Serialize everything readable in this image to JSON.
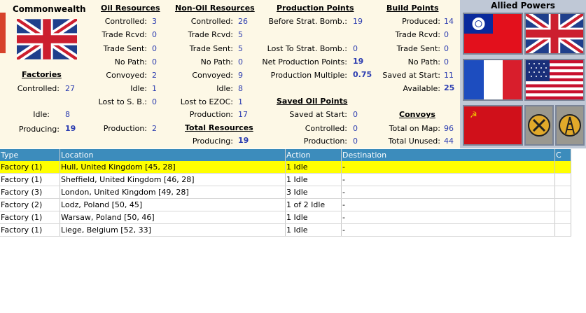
{
  "country": "Commonwealth",
  "factories": {
    "header": "Factories",
    "controlled_label": "Controlled:",
    "controlled": "27",
    "idle_label": "Idle:",
    "idle": "8",
    "producing_label": "Producing:",
    "producing": "19"
  },
  "oil": {
    "header": "Oil Resources",
    "controlled_label": "Controlled:",
    "controlled": "3",
    "trade_rcvd_label": "Trade Rcvd:",
    "trade_rcvd": "0",
    "trade_sent_label": "Trade Sent:",
    "trade_sent": "0",
    "no_path_label": "No Path:",
    "no_path": "0",
    "convoyed_label": "Convoyed:",
    "convoyed": "2",
    "idle_label": "Idle:",
    "idle": "1",
    "lost_sb_label": "Lost to S. B.:",
    "lost_sb": "0",
    "production_label": "Production:",
    "production": "2"
  },
  "nonoil": {
    "header": "Non-Oil Resources",
    "controlled_label": "Controlled:",
    "controlled": "26",
    "trade_rcvd_label": "Trade Rcvd:",
    "trade_rcvd": "5",
    "trade_sent_label": "Trade Sent:",
    "trade_sent": "5",
    "no_path_label": "No Path:",
    "no_path": "0",
    "convoyed_label": "Convoyed:",
    "convoyed": "9",
    "idle_label": "Idle:",
    "idle": "8",
    "lost_ezoc_label": "Lost to EZOC:",
    "lost_ezoc": "1",
    "production_label": "Production:",
    "production": "17"
  },
  "total": {
    "header": "Total Resources",
    "producing_label": "Producing:",
    "producing": "19"
  },
  "pp": {
    "header": "Production Points",
    "before_label": "Before Strat. Bomb.:",
    "before": "19",
    "lost_label": "Lost To Strat. Bomb.:",
    "lost": "0",
    "net_label": "Net Production Points:",
    "net": "19",
    "mult_label": "Production Multiple:",
    "mult": "0.75"
  },
  "saved_oil": {
    "header": "Saved Oil Points",
    "saved_label": "Saved at Start:",
    "saved": "0",
    "controlled_label": "Controlled:",
    "controlled": "0",
    "production_label": "Production:",
    "production": "0"
  },
  "bp": {
    "header": "Build Points",
    "produced_label": "Produced:",
    "produced": "14",
    "trade_rcvd_label": "Trade Rcvd:",
    "trade_rcvd": "0",
    "trade_sent_label": "Trade Sent:",
    "trade_sent": "0",
    "no_path_label": "No Path:",
    "no_path": "0",
    "saved_label": "Saved at Start:",
    "saved": "11",
    "available_label": "Available:",
    "available": "25"
  },
  "convoys": {
    "header": "Convoys",
    "total_map_label": "Total on Map:",
    "total_map": "96",
    "total_unused_label": "Total Unused:",
    "total_unused": "44"
  },
  "allied": {
    "title": "Allied Powers"
  },
  "table": {
    "headers": [
      "Type",
      "Location",
      "Action",
      "Destination",
      "C"
    ],
    "rows": [
      [
        "Factory (1)",
        "Hull, United Kingdom [45, 28]",
        "1 Idle",
        "-",
        ""
      ],
      [
        "Factory (1)",
        "Sheffield, United Kingdom [46, 28]",
        "1 Idle",
        "-",
        ""
      ],
      [
        "Factory (3)",
        "London, United Kingdom [49, 28]",
        "3 Idle",
        "-",
        ""
      ],
      [
        "Factory (2)",
        "Lodz, Poland [50, 45]",
        "1 of 2 Idle",
        "-",
        ""
      ],
      [
        "Factory (1)",
        "Warsaw, Poland [50, 46]",
        "1 Idle",
        "-",
        ""
      ],
      [
        "Factory (1)",
        "Liege, Belgium [52, 33]",
        "1 Idle",
        "-",
        ""
      ]
    ]
  },
  "colors": {
    "value_blue": "#2b3cb0",
    "selected_row": "#ffff00",
    "table_header": "#3c8cbc",
    "panel_bg": "#fdf8e6"
  }
}
